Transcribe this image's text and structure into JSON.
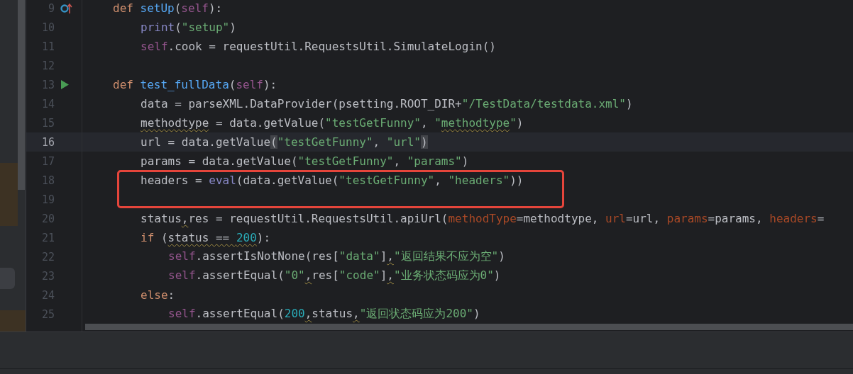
{
  "editor": {
    "lines": [
      {
        "number": "9",
        "current": false,
        "boxed": false,
        "gutter": {
          "kind": "override"
        },
        "tokens": [
          {
            "kind": "keyword",
            "text": "def "
          },
          {
            "kind": "function",
            "text": "setUp"
          },
          {
            "kind": "plain",
            "text": "("
          },
          {
            "kind": "self",
            "text": "self"
          },
          {
            "kind": "plain",
            "text": "):"
          }
        ],
        "children": [
          {
            "number": "10",
            "current": false,
            "boxed": false,
            "tokens": [
              {
                "kind": "builtin",
                "text": "print"
              },
              {
                "kind": "plain",
                "text": "("
              },
              {
                "kind": "string",
                "text": "\"setup\""
              },
              {
                "kind": "plain",
                "text": ")"
              }
            ]
          },
          {
            "number": "11",
            "current": false,
            "boxed": false,
            "tokens": [
              {
                "kind": "self",
                "text": "self"
              },
              {
                "kind": "plain",
                "text": ".cook = requestUtil.RequestsUtil.SimulateLogin()"
              }
            ]
          },
          {
            "number": "12",
            "current": false,
            "boxed": false
          }
        ]
      },
      {
        "number": "13",
        "current": false,
        "boxed": false,
        "gutter": {
          "kind": "run"
        },
        "tokens": [
          {
            "kind": "keyword",
            "text": "def "
          },
          {
            "kind": "function",
            "text": "test_fullData"
          },
          {
            "kind": "plain",
            "text": "("
          },
          {
            "kind": "self",
            "text": "self"
          },
          {
            "kind": "plain",
            "text": "):"
          }
        ],
        "children": [
          {
            "number": "14",
            "current": false,
            "boxed": false,
            "tokens": [
              {
                "kind": "plain",
                "text": "data = parseXML.DataProvider(psetting.ROOT_DIR+"
              },
              {
                "kind": "string",
                "text": "\"/TestData/testdata.xml\""
              },
              {
                "kind": "plain",
                "text": ")"
              }
            ]
          },
          {
            "number": "15",
            "current": false,
            "boxed": false,
            "tokens": [
              {
                "kind": "plain",
                "text": "methodtype",
                "warned": true
              },
              {
                "kind": "plain",
                "text": " = data.getValue("
              },
              {
                "kind": "string",
                "text": "\"testGetFunny\""
              },
              {
                "kind": "plain",
                "text": ", "
              },
              {
                "kind": "string",
                "text": "\""
              },
              {
                "kind": "string",
                "text": "methodtype",
                "warned": true
              },
              {
                "kind": "string",
                "text": "\""
              },
              {
                "kind": "plain",
                "text": ")"
              }
            ]
          },
          {
            "number": "16",
            "current": true,
            "boxed": false,
            "tokens": [
              {
                "kind": "plain",
                "text": "url = data.getValue"
              },
              {
                "kind": "plain",
                "text": "(",
                "matched": true
              },
              {
                "kind": "string",
                "text": "\"testGetFunny\""
              },
              {
                "kind": "plain",
                "text": ", "
              },
              {
                "kind": "string",
                "text": "\"url\""
              },
              {
                "kind": "plain",
                "text": ")",
                "matched": true
              }
            ]
          },
          {
            "number": "17",
            "current": false,
            "boxed": false,
            "tokens": [
              {
                "kind": "plain",
                "text": "params = data.getValue("
              },
              {
                "kind": "string",
                "text": "\"testGetFunny\""
              },
              {
                "kind": "plain",
                "text": ", "
              },
              {
                "kind": "string",
                "text": "\"params\""
              },
              {
                "kind": "plain",
                "text": ")"
              }
            ]
          },
          {
            "number": "18",
            "current": false,
            "boxed": true,
            "tokens": [
              {
                "kind": "plain",
                "text": "headers = "
              },
              {
                "kind": "builtin",
                "text": "eval"
              },
              {
                "kind": "plain",
                "text": "(data.getValue("
              },
              {
                "kind": "string",
                "text": "\"testGetFunny\""
              },
              {
                "kind": "plain",
                "text": ", "
              },
              {
                "kind": "string",
                "text": "\"headers\""
              },
              {
                "kind": "plain",
                "text": "))"
              }
            ]
          },
          {
            "number": "19",
            "current": false,
            "boxed": true
          },
          {
            "number": "20",
            "current": false,
            "boxed": false,
            "tokens": [
              {
                "kind": "plain",
                "text": "status"
              },
              {
                "kind": "plain",
                "text": ",",
                "warned": true
              },
              {
                "kind": "plain",
                "text": "res = requestUtil.RequestsUtil.apiUrl("
              },
              {
                "kind": "param",
                "text": "methodType"
              },
              {
                "kind": "plain",
                "text": "=methodtype, "
              },
              {
                "kind": "param",
                "text": "url"
              },
              {
                "kind": "plain",
                "text": "=url, "
              },
              {
                "kind": "param",
                "text": "params"
              },
              {
                "kind": "plain",
                "text": "=params, "
              },
              {
                "kind": "param",
                "text": "headers"
              },
              {
                "kind": "plain",
                "text": "="
              }
            ]
          },
          {
            "number": "21",
            "current": false,
            "boxed": false,
            "tokens": [
              {
                "kind": "keyword",
                "text": "if "
              },
              {
                "kind": "plain",
                "text": "("
              },
              {
                "kind": "plain",
                "text": "status == ",
                "warned": true
              },
              {
                "kind": "number",
                "text": "200",
                "warned": true
              },
              {
                "kind": "plain",
                "text": "):"
              }
            ],
            "children": [
              {
                "number": "22",
                "current": false,
                "boxed": false,
                "tokens": [
                  {
                    "kind": "self",
                    "text": "self"
                  },
                  {
                    "kind": "plain",
                    "text": ".assertIsNotNone(res["
                  },
                  {
                    "kind": "string",
                    "text": "\"data\""
                  },
                  {
                    "kind": "plain",
                    "text": "]"
                  },
                  {
                    "kind": "plain",
                    "text": ",",
                    "warned": true
                  },
                  {
                    "kind": "string",
                    "text": "\"返回结果不应为空\""
                  },
                  {
                    "kind": "plain",
                    "text": ")"
                  }
                ]
              },
              {
                "number": "23",
                "current": false,
                "boxed": false,
                "tokens": [
                  {
                    "kind": "self",
                    "text": "self"
                  },
                  {
                    "kind": "plain",
                    "text": ".assertEqual("
                  },
                  {
                    "kind": "string",
                    "text": "\"0\""
                  },
                  {
                    "kind": "plain",
                    "text": ",",
                    "warned": true
                  },
                  {
                    "kind": "plain",
                    "text": "res["
                  },
                  {
                    "kind": "string",
                    "text": "\"code\""
                  },
                  {
                    "kind": "plain",
                    "text": "]"
                  },
                  {
                    "kind": "plain",
                    "text": ",",
                    "warned": true
                  },
                  {
                    "kind": "string",
                    "text": "\"业务状态码应为0\""
                  },
                  {
                    "kind": "plain",
                    "text": ")"
                  }
                ]
              }
            ]
          },
          {
            "number": "24",
            "current": false,
            "boxed": false,
            "tokens": [
              {
                "kind": "keyword",
                "text": "else"
              },
              {
                "kind": "plain",
                "text": ":"
              }
            ],
            "children": [
              {
                "number": "25",
                "current": false,
                "boxed": false,
                "tokens": [
                  {
                    "kind": "self",
                    "text": "self"
                  },
                  {
                    "kind": "plain",
                    "text": ".assertEqual("
                  },
                  {
                    "kind": "number",
                    "text": "200"
                  },
                  {
                    "kind": "plain",
                    "text": ",",
                    "warned": true
                  },
                  {
                    "kind": "plain",
                    "text": "status"
                  },
                  {
                    "kind": "plain",
                    "text": ",",
                    "warned": true
                  },
                  {
                    "kind": "string",
                    "text": "\"返回状态码应为200\""
                  },
                  {
                    "kind": "plain",
                    "text": ")"
                  }
                ]
              }
            ]
          }
        ]
      }
    ]
  }
}
